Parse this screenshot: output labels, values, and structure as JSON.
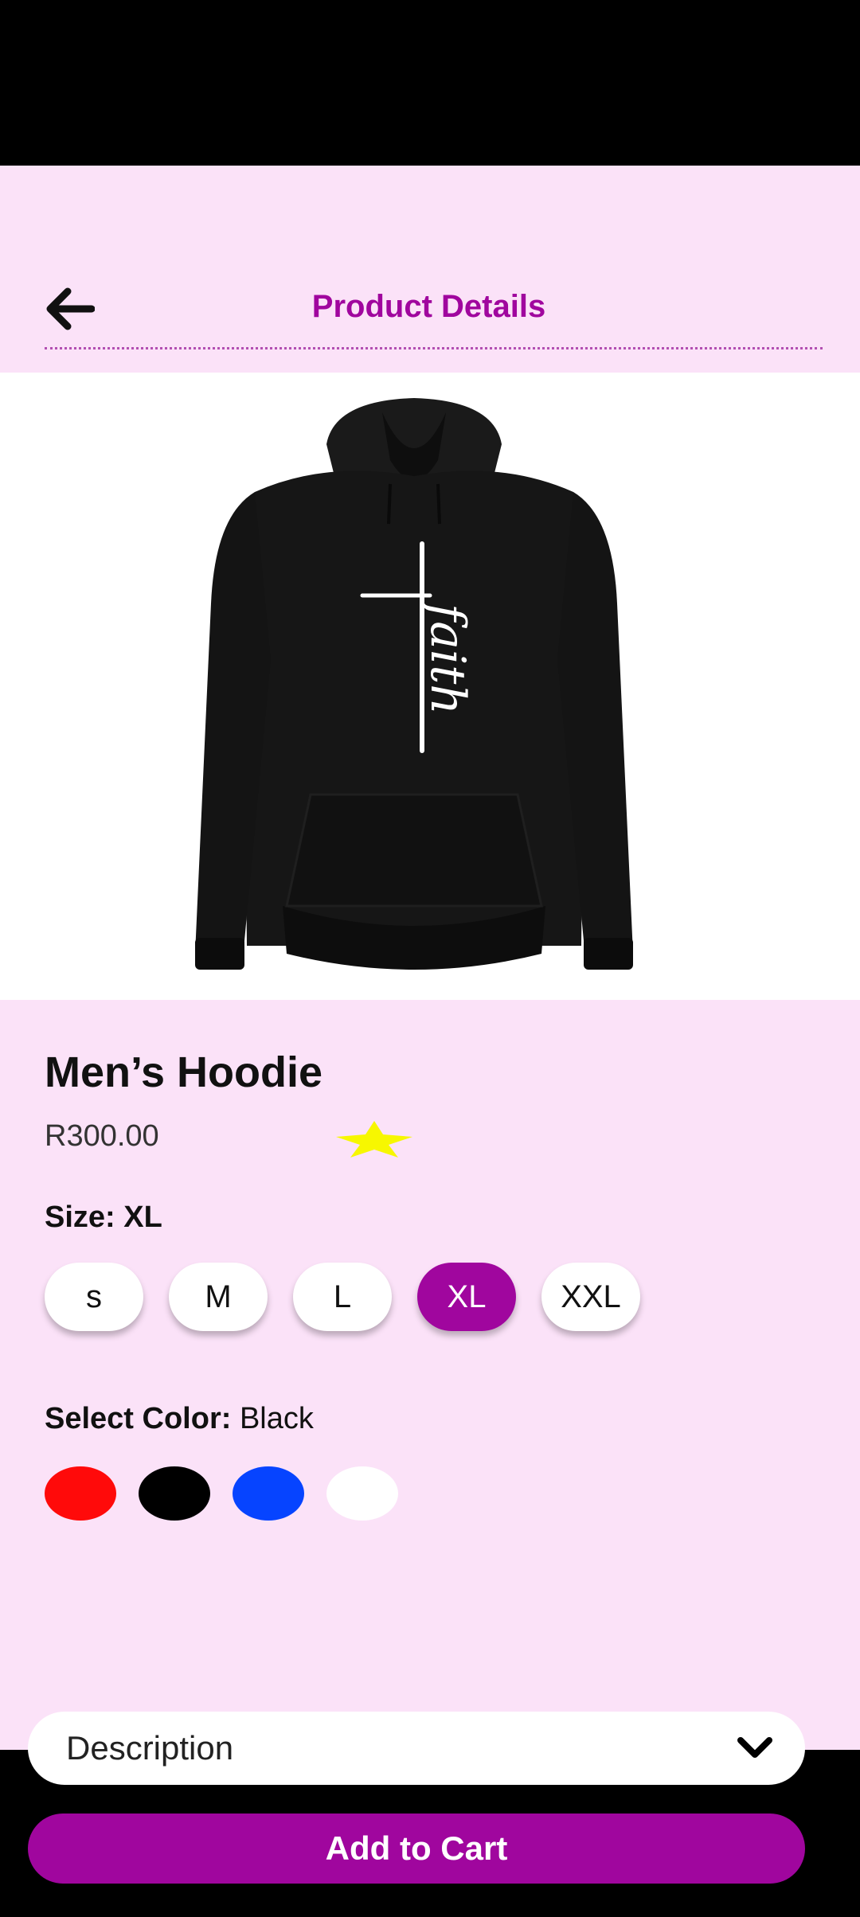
{
  "header": {
    "title": "Product Details",
    "back_icon": "arrow-left-icon"
  },
  "product": {
    "name": "Men’s Hoodie",
    "price": "R300.00",
    "rating_icon": "star-icon",
    "print_text": "faith"
  },
  "size": {
    "label": "Size: XL",
    "options": [
      "s",
      "M",
      "L",
      "XL",
      "XXL"
    ],
    "selected": "XL"
  },
  "color": {
    "label_bold": "Select Color:",
    "label_value": " Black",
    "options": [
      {
        "name": "red",
        "hex": "#ff0a0a"
      },
      {
        "name": "black",
        "hex": "#000000"
      },
      {
        "name": "blue",
        "hex": "#0644ff"
      },
      {
        "name": "white",
        "hex": "#ffffff"
      }
    ]
  },
  "description": {
    "label": "Description",
    "icon": "chevron-down-icon"
  },
  "cart": {
    "label": "Add to Cart"
  },
  "colors": {
    "accent": "#a0069e",
    "background": "#fbe2f8",
    "star": "#f7f700"
  }
}
